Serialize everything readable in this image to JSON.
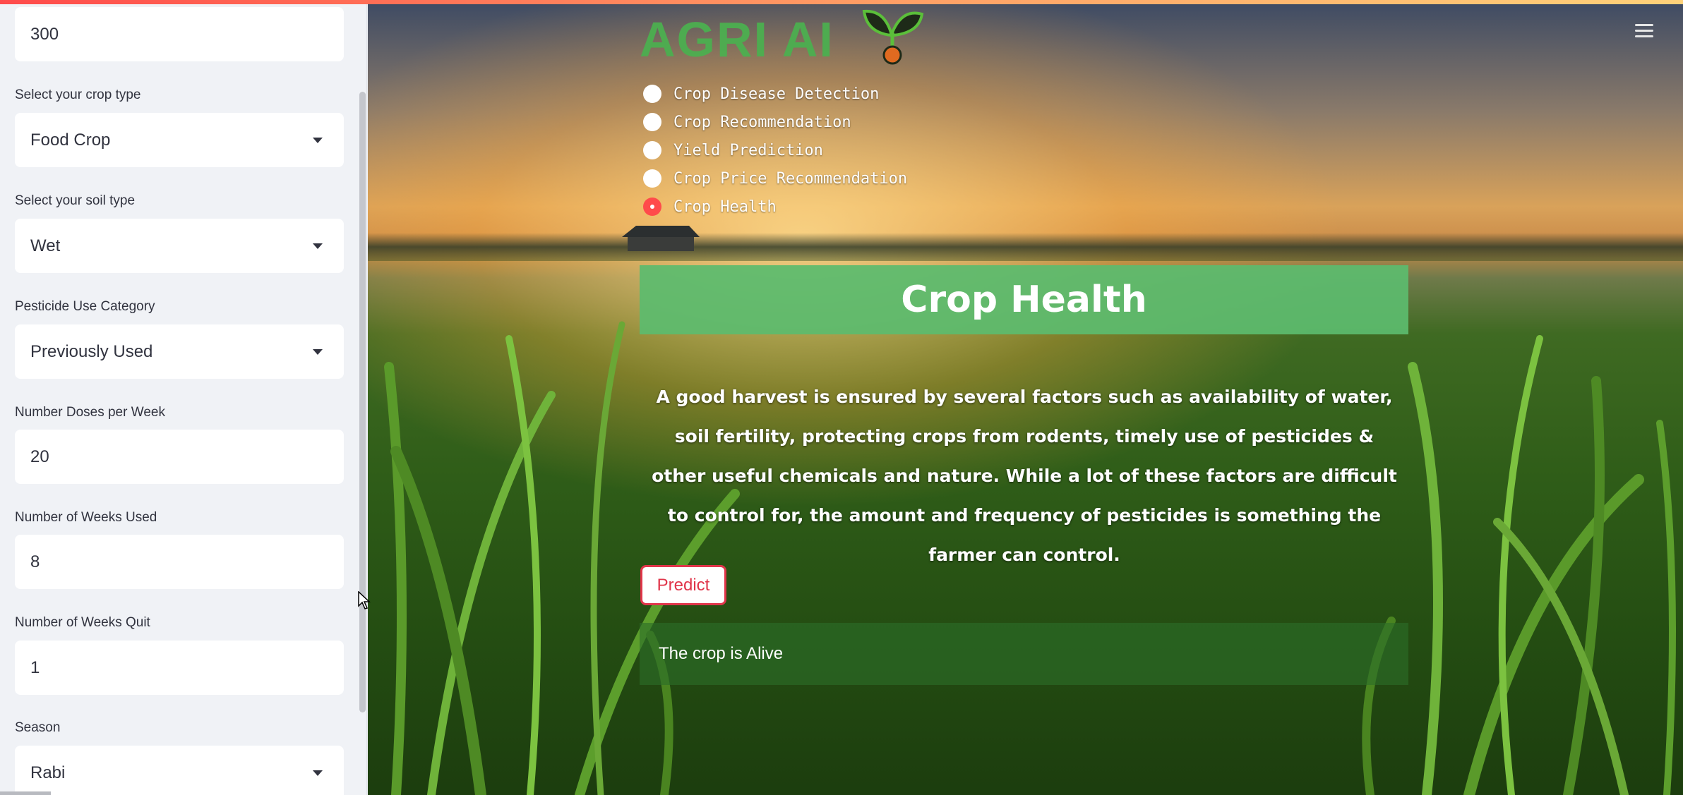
{
  "sidebar": {
    "top_input_value": "300",
    "crop_type": {
      "label": "Select your crop type",
      "value": "Food Crop"
    },
    "soil_type": {
      "label": "Select your soil type",
      "value": "Wet"
    },
    "pesticide_category": {
      "label": "Pesticide Use Category",
      "value": "Previously Used"
    },
    "doses_per_week": {
      "label": "Number Doses per Week",
      "value": "20"
    },
    "weeks_used": {
      "label": "Number of Weeks Used",
      "value": "8"
    },
    "weeks_quit": {
      "label": "Number of Weeks Quit",
      "value": "1"
    },
    "season": {
      "label": "Season",
      "value": "Rabi"
    }
  },
  "header": {
    "logo_text": "AGRI AI",
    "menu_icon": "hamburger-menu-icon"
  },
  "nav": {
    "options": [
      {
        "label": "Crop Disease Detection",
        "selected": false
      },
      {
        "label": "Crop Recommendation",
        "selected": false
      },
      {
        "label": "Yield Prediction",
        "selected": false
      },
      {
        "label": "Crop Price Recommendation",
        "selected": false
      },
      {
        "label": "Crop Health",
        "selected": true
      }
    ]
  },
  "main": {
    "title": "Crop Health",
    "description": "A good harvest is ensured by several factors such as availability of water, soil fertility, protecting crops from rodents, timely use of pesticides & other useful chemicals and nature. While a lot of these factors are difficult to control for, the amount and frequency of pesticides is something the farmer can control.",
    "predict_label": "Predict",
    "result_text": "The crop is Alive"
  },
  "colors": {
    "accent_red": "#ff4b4b",
    "button_border": "#e0354a",
    "banner_green": "#5cbb6e",
    "logo_green": "#4caf50"
  }
}
